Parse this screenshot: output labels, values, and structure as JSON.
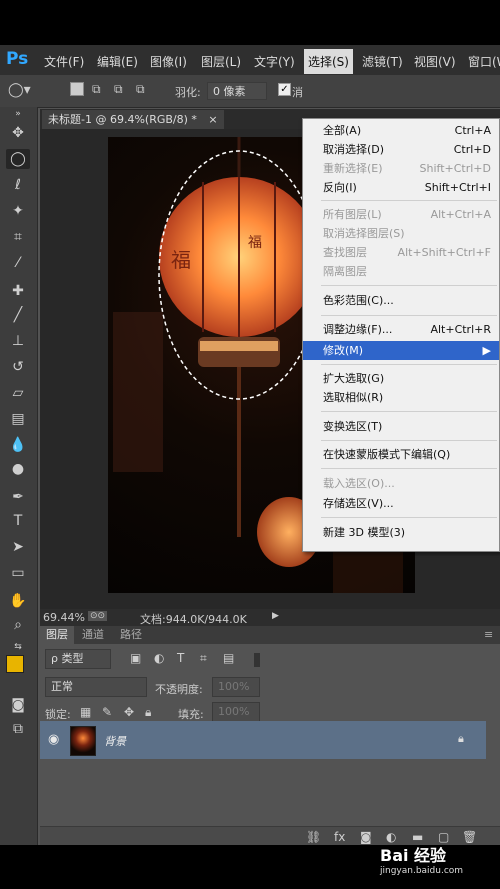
{
  "app": {
    "logo": "Ps"
  },
  "menubar": [
    {
      "label": "文件(F)"
    },
    {
      "label": "编辑(E)"
    },
    {
      "label": "图像(I)"
    },
    {
      "label": "图层(L)"
    },
    {
      "label": "文字(Y)"
    },
    {
      "label": "选择(S)"
    },
    {
      "label": "滤镜(T)"
    },
    {
      "label": "视图(V)"
    },
    {
      "label": "窗口(W)"
    }
  ],
  "options": {
    "feather_label": "羽化:",
    "feather_value": "0 像素",
    "antialias_label": "消"
  },
  "document": {
    "tab_label": "未标题-1 @ 69.4%(RGB/8) *"
  },
  "status": {
    "zoom": "69.44%",
    "doc_info": "文档:944.0K/944.0K"
  },
  "select_menu": {
    "items": [
      {
        "label": "全部(A)",
        "shortcut": "Ctrl+A",
        "disabled": false
      },
      {
        "label": "取消选择(D)",
        "shortcut": "Ctrl+D",
        "disabled": false
      },
      {
        "label": "重新选择(E)",
        "shortcut": "Shift+Ctrl+D",
        "disabled": true
      },
      {
        "label": "反向(I)",
        "shortcut": "Shift+Ctrl+I",
        "disabled": false
      },
      {
        "label": "所有图层(L)",
        "shortcut": "Alt+Ctrl+A",
        "disabled": true
      },
      {
        "label": "取消选择图层(S)",
        "shortcut": "",
        "disabled": true
      },
      {
        "label": "查找图层",
        "shortcut": "Alt+Shift+Ctrl+F",
        "disabled": true
      },
      {
        "label": "隔离图层",
        "shortcut": "",
        "disabled": true
      },
      {
        "label": "色彩范围(C)...",
        "shortcut": "",
        "disabled": false
      },
      {
        "label": "调整边缘(F)...",
        "shortcut": "Alt+Ctrl+R",
        "disabled": false
      },
      {
        "label": "修改(M)",
        "shortcut": "",
        "disabled": false,
        "highlighted": true
      },
      {
        "label": "扩大选取(G)",
        "shortcut": "",
        "disabled": false
      },
      {
        "label": "选取相似(R)",
        "shortcut": "",
        "disabled": false
      },
      {
        "label": "变换选区(T)",
        "shortcut": "",
        "disabled": false
      },
      {
        "label": "在快速蒙版模式下编辑(Q)",
        "shortcut": "",
        "disabled": false
      },
      {
        "label": "载入选区(O)...",
        "shortcut": "",
        "disabled": true
      },
      {
        "label": "存储选区(V)...",
        "shortcut": "",
        "disabled": false
      },
      {
        "label": "新建 3D 模型(3)",
        "shortcut": "",
        "disabled": false
      }
    ]
  },
  "layers_panel": {
    "tabs": [
      "图层",
      "通道",
      "路径"
    ],
    "filter_label": "ρ 类型",
    "blend_mode": "正常",
    "opacity_label": "不透明度:",
    "opacity_value": "100%",
    "lock_label": "锁定:",
    "fill_label": "填充:",
    "fill_value": "100%",
    "layer_name": "背景"
  },
  "watermark": {
    "text": "Bai 经验",
    "url": "jingyan.baidu.com"
  },
  "colors": {
    "accent": "#2f65ca",
    "foreground": "#e8b400",
    "background": "#ffffff"
  }
}
